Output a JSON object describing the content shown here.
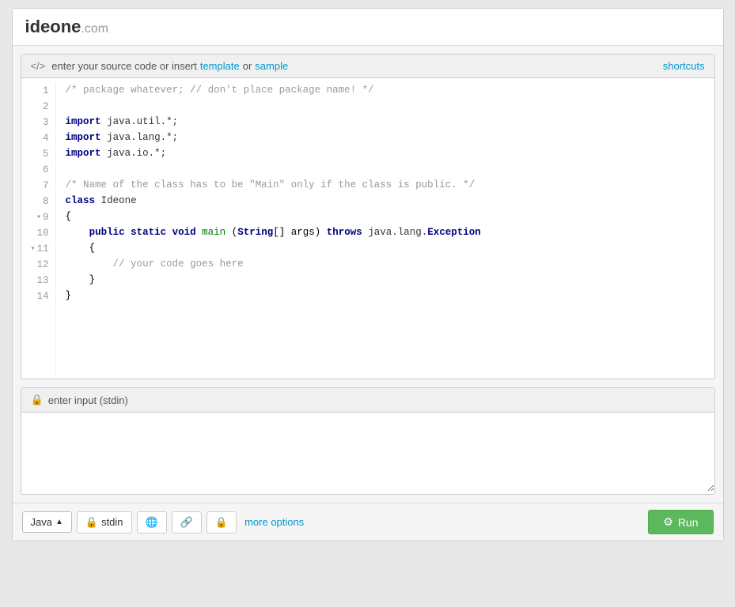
{
  "header": {
    "logo_text": "ideone",
    "logo_com": ".com"
  },
  "code_panel": {
    "header_icon": "</>",
    "header_text": " enter your source code or insert ",
    "template_link": "template",
    "or_text": " or ",
    "sample_link": "sample",
    "shortcuts_label": "shortcuts"
  },
  "code_lines": [
    {
      "num": 1,
      "fold": false,
      "content": "/* package whatever; // don't place package name! */",
      "type": "comment"
    },
    {
      "num": 2,
      "fold": false,
      "content": "",
      "type": "normal"
    },
    {
      "num": 3,
      "fold": false,
      "content": "import java.util.*;",
      "type": "import"
    },
    {
      "num": 4,
      "fold": false,
      "content": "import java.lang.*;",
      "type": "import"
    },
    {
      "num": 5,
      "fold": false,
      "content": "import java.io.*;",
      "type": "import"
    },
    {
      "num": 6,
      "fold": false,
      "content": "",
      "type": "normal"
    },
    {
      "num": 7,
      "fold": false,
      "content": "/* Name of the class has to be \"Main\" only if the class is public. */",
      "type": "comment"
    },
    {
      "num": 8,
      "fold": false,
      "content": "class Ideone",
      "type": "class"
    },
    {
      "num": 9,
      "fold": true,
      "content": "{",
      "type": "normal"
    },
    {
      "num": 10,
      "fold": false,
      "content": "    public static void main (String[] args) throws java.lang.Exception",
      "type": "method"
    },
    {
      "num": 11,
      "fold": true,
      "content": "    {",
      "type": "normal"
    },
    {
      "num": 12,
      "fold": false,
      "content": "        // your code goes here",
      "type": "comment_inner"
    },
    {
      "num": 13,
      "fold": false,
      "content": "    }",
      "type": "normal"
    },
    {
      "num": 14,
      "fold": false,
      "content": "}",
      "type": "normal"
    }
  ],
  "stdin_panel": {
    "icon": "🔒",
    "header_text": "enter input (stdin)",
    "placeholder": ""
  },
  "toolbar": {
    "java_label": "Java",
    "stdin_label": "stdin",
    "more_options_label": "more options",
    "run_label": "Run"
  }
}
